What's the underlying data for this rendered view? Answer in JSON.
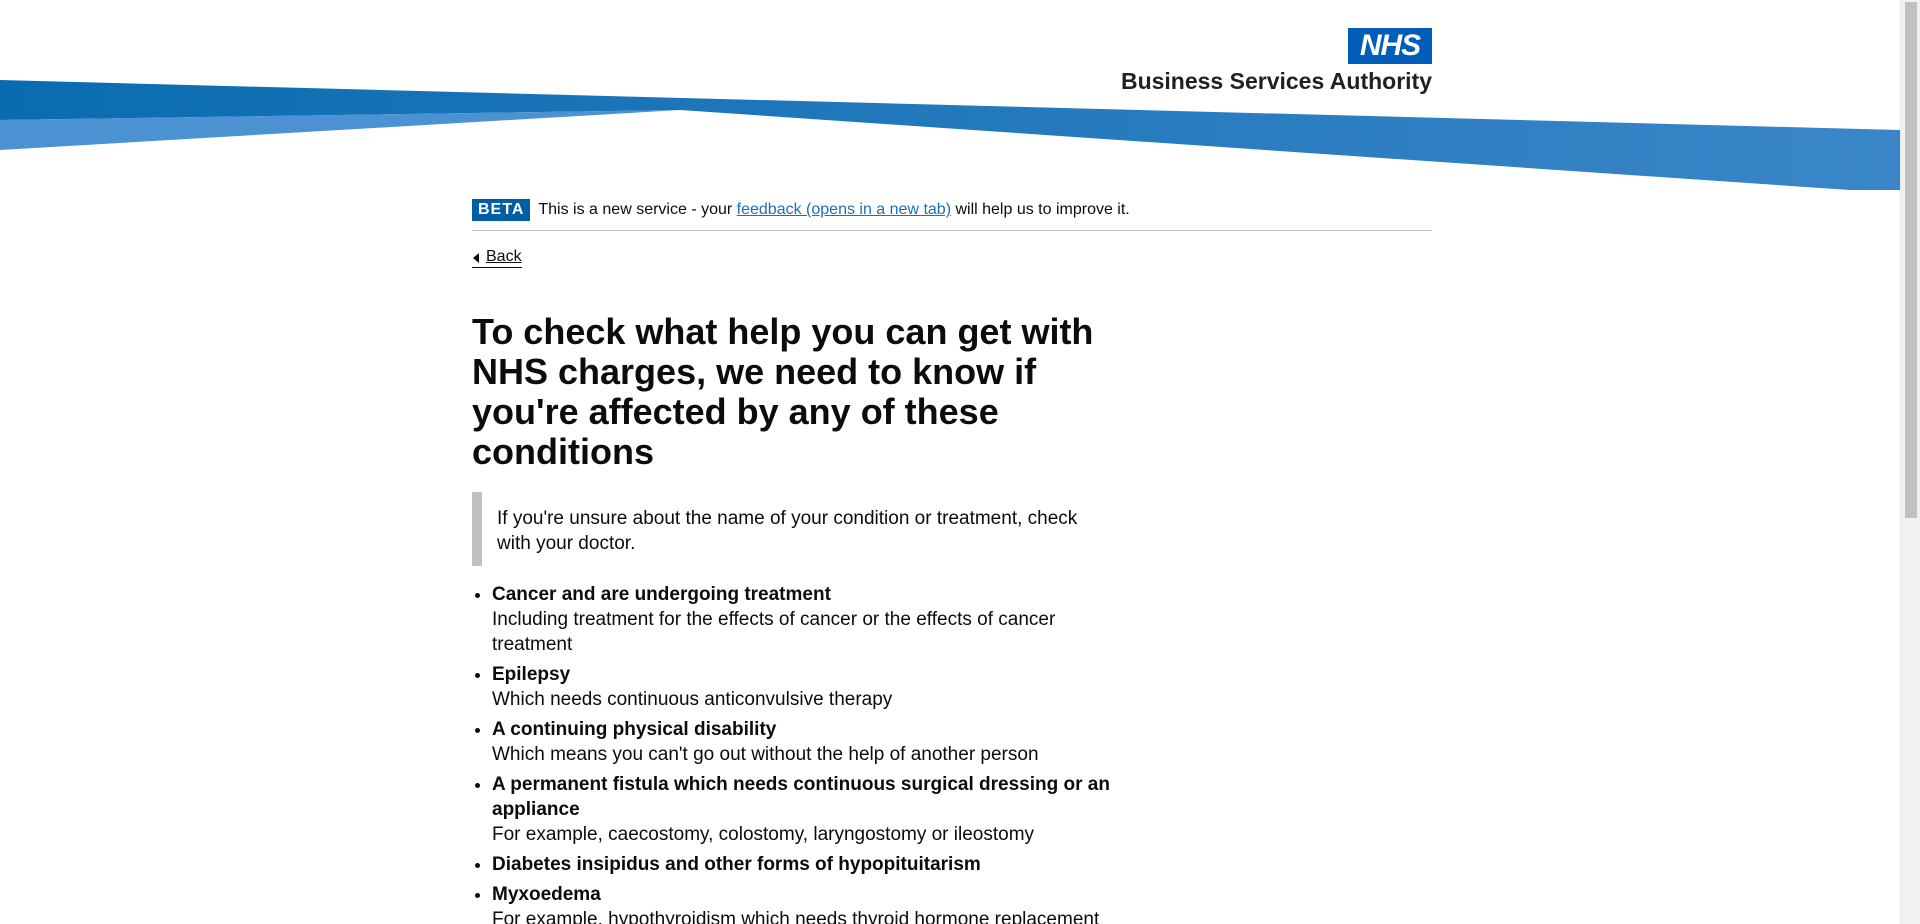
{
  "header": {
    "logo_text": "NHS",
    "org_name": "Business Services Authority",
    "colors": {
      "brand_blue": "#005eb8",
      "swoosh_dark": "#0a6cb0",
      "swoosh_light": "#4a90d0"
    }
  },
  "beta_banner": {
    "tag": "BETA",
    "text_before": "This is a new service - your ",
    "link_text": "feedback (opens in a new tab)",
    "text_after": " will help us to improve it."
  },
  "back_link": {
    "label": "Back"
  },
  "page_title": "To check what help you can get with NHS charges, we need to know if you're affected by any of these conditions",
  "inset_text": "If you're unsure about the name of your condition or treatment, check with your doctor.",
  "conditions": [
    {
      "title": "Cancer and are undergoing treatment",
      "desc": "Including treatment for the effects of cancer or the effects of cancer treatment"
    },
    {
      "title": "Epilepsy",
      "desc": "Which needs continuous anticonvulsive therapy"
    },
    {
      "title": "A continuing physical disability",
      "desc": "Which means you can't go out without the help of another person"
    },
    {
      "title": "A permanent fistula which needs continuous surgical dressing or an appliance",
      "desc": "For example, caecostomy, colostomy, laryngostomy or ileostomy"
    },
    {
      "title": "Diabetes insipidus and other forms of hypopituitarism",
      "desc": ""
    },
    {
      "title": "Myxoedema",
      "desc": "For example, hypothyroidism which needs thyroid hormone replacement"
    }
  ]
}
